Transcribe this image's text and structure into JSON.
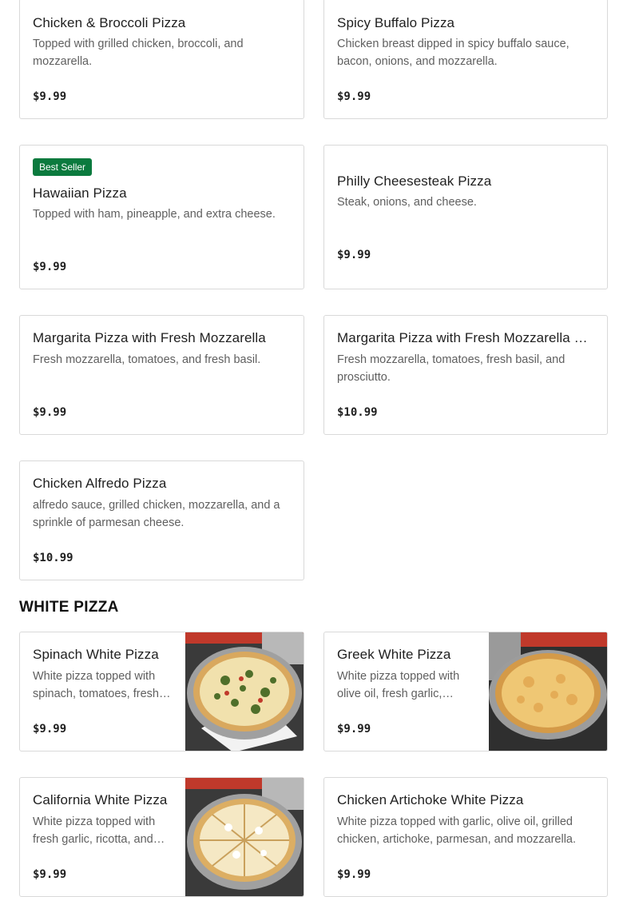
{
  "menu": {
    "items": [
      {
        "title": "Chicken & Broccoli Pizza",
        "description": "Topped with grilled chicken, broccoli, and mozzarella.",
        "price": "$9.99"
      },
      {
        "title": "Spicy Buffalo Pizza",
        "description": "Chicken breast dipped in spicy buffalo sauce, bacon, onions, and mozzarella.",
        "price": "$9.99"
      },
      {
        "title": "Hawaiian Pizza",
        "description": "Topped with ham, pineapple, and extra cheese.",
        "price": "$9.99",
        "badge": "Best Seller"
      },
      {
        "title": "Philly Cheesesteak Pizza",
        "description": "Steak, onions, and cheese.",
        "price": "$9.99"
      },
      {
        "title": "Margarita Pizza with Fresh Mozzarella",
        "description": "Fresh mozzarella, tomatoes, and fresh basil.",
        "price": "$9.99"
      },
      {
        "title": "Margarita Pizza with Fresh Mozzarella &…",
        "description": "Fresh mozzarella, tomatoes, fresh basil, and prosciutto.",
        "price": "$10.99"
      },
      {
        "title": "Chicken Alfredo Pizza",
        "description": "alfredo sauce, grilled chicken, mozzarella, and a sprinkle of parmesan cheese.",
        "price": "$10.99"
      }
    ]
  },
  "white_pizza": {
    "heading": "WHITE PIZZA",
    "items": [
      {
        "title": "Spinach White Pizza",
        "description": "White pizza topped with spinach, tomatoes, fresh…",
        "price": "$9.99"
      },
      {
        "title": "Greek White Pizza",
        "description": "White pizza topped with olive oil, fresh garlic,…",
        "price": "$9.99"
      },
      {
        "title": "California White Pizza",
        "description": "White pizza topped with fresh garlic, ricotta, and…",
        "price": "$9.99"
      },
      {
        "title": "Chicken Artichoke White Pizza",
        "description": "White pizza topped with garlic, olive oil, grilled chicken, artichoke, parmesan, and mozzarella.",
        "price": "$9.99"
      }
    ]
  },
  "colors": {
    "badge": "#0b7a3e",
    "border": "#d9d9d9",
    "description": "#5f5f5f"
  }
}
